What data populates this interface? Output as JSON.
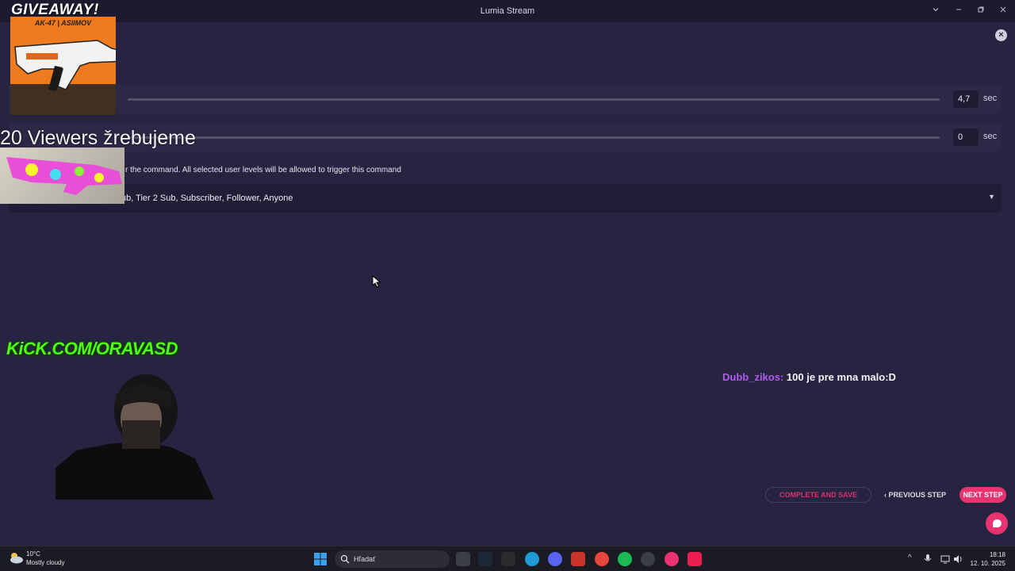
{
  "window": {
    "title": "Lumia Stream"
  },
  "sliders": [
    {
      "value": "4,7",
      "unit": "sec"
    },
    {
      "value": "0",
      "unit": "sec"
    }
  ],
  "user_levels": {
    "description_visible": "r the command. All selected user levels will be allowed to trigger this command",
    "selected_visible": "ub, Tier 2 Sub, Subscriber, Follower, Anyone"
  },
  "chat": {
    "username": "Dubb_zikos:",
    "message": "100 je pre mna malo:D"
  },
  "wizard": {
    "complete_label": "COMPLETE AND SAVE",
    "previous_label": "PREVIOUS STEP",
    "next_label": "NEXT STEP"
  },
  "overlay": {
    "giveaway_title": "GIVEAWAY!",
    "giveaway_item": "AK-47 | ASIIMOV",
    "viewers_text": "20 Viewers žrebujeme",
    "kick_url": "KiCK.COM/ORAVASD"
  },
  "taskbar": {
    "weather_temp": "10°C",
    "weather_condition": "Mostly cloudy",
    "search_placeholder": "Hľadať",
    "time": "18:18",
    "date": "12. 10. 2025"
  },
  "colors": {
    "accent": "#e8336e",
    "background": "#262440",
    "chat_user": "#b35bf0",
    "kick_green": "#53fc18"
  }
}
